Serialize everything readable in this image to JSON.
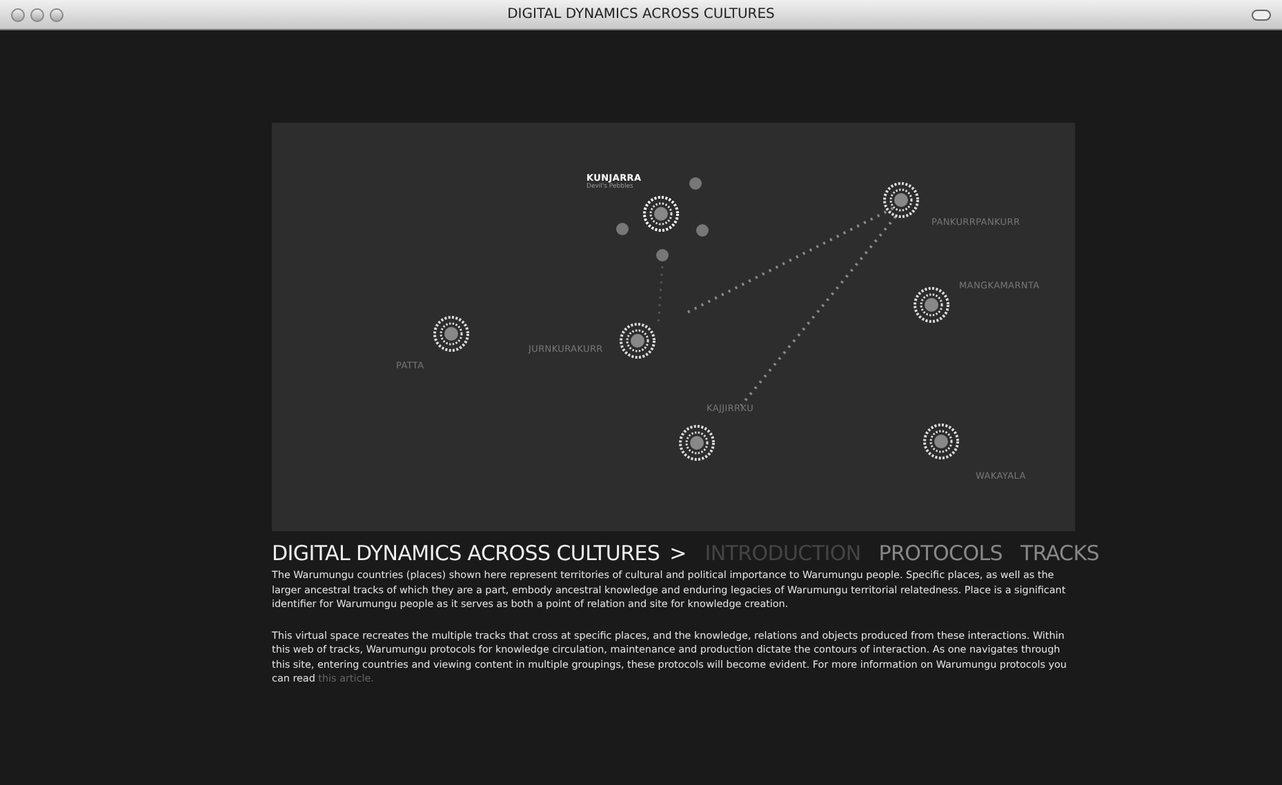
{
  "window": {
    "title": "DIGITAL DYNAMICS ACROSS CULTURES"
  },
  "map": {
    "places": [
      {
        "name": "KUNJARRA",
        "subtitle": "Devil's Pebbles",
        "selected": true
      },
      {
        "name": "PANKURRPANKURR",
        "selected": false
      },
      {
        "name": "MANGKAMARNTA",
        "selected": false
      },
      {
        "name": "JURNKURAKURR",
        "selected": false
      },
      {
        "name": "PATTA",
        "selected": false
      },
      {
        "name": "KAJJIRRKU",
        "selected": false
      },
      {
        "name": "WAKAYALA",
        "selected": false
      }
    ]
  },
  "nav": {
    "title": "DIGITAL DYNAMICS ACROSS CULTURES",
    "separator": ">",
    "items": [
      {
        "label": "INTRODUCTION",
        "selected": true
      },
      {
        "label": "PROTOCOLS",
        "selected": false
      },
      {
        "label": "TRACKS",
        "selected": false
      }
    ]
  },
  "paragraphs": [
    "The Warumungu countries (places) shown here represent territories of cultural and political importance to Warumungu people. Specific places, as well as the larger ancestral tracks of which they are a part, embody ancestral knowledge and enduring legacies of Warumungu territorial relatedness. Place is a significant identifier for Warumungu people as it serves as both a point of relation and site for knowledge creation.",
    "This virtual space recreates the multiple tracks that cross at specific places, and the knowledge, relations and objects produced from these interactions. Within this web of tracks, Warumungu protocols for knowledge circulation, maintenance and production dictate the contours of interaction. As one navigates through this site, entering countries and viewing content in multiple groupings, these protocols will become evident. For more information on Warumungu protocols you can read"
  ],
  "link": "this article."
}
